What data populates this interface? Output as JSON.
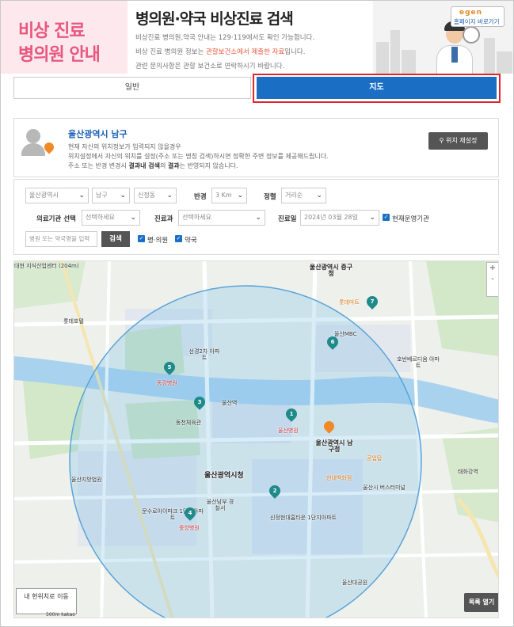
{
  "banner": {
    "left_line1": "비상 진료",
    "left_line2": "병의원 안내",
    "title": "병의원·약국 비상진료 검색",
    "info1": "비상진료 병의원,약국 안내는 129·119에서도 확인 가능합니다.",
    "info2_pre": "비상 진료 병의원 정보는 ",
    "info2_hl": "관할보건소에서 제출한 자료",
    "info2_post": "입니다.",
    "info3": "관련 문의사항은 관할 보건소로 연락하시기 바랍니다.",
    "home_logo": "egen",
    "home_label": "홈페이지 바로가기"
  },
  "tabs": {
    "normal": "일반",
    "map": "지도"
  },
  "location": {
    "title": "울산광역시 남구",
    "line1": "현재 자신의 위치정보가 입력되지 않을경우",
    "line2": "위치설정에서 자신의 위치를 설정(주소 또는 명칭 검색)하시면 정확한 주변 정보를 제공해드립니다.",
    "line3_pre": "주소 또는 반경 변경시 ",
    "line3_b1": "결과내 검색",
    "line3_mid": "의 ",
    "line3_b2": "결과",
    "line3_post": "는 반영되지 않습니다.",
    "reset_label": "위치 재설정"
  },
  "filters": {
    "city": "울산광역시",
    "district": "남구",
    "dong": "신정동",
    "radius_label": "반경",
    "radius": "3 Km",
    "sort_label": "정렬",
    "sort": "거리순",
    "org_label": "의료기관 선택",
    "org": "선택하세요",
    "dept_label": "진료과",
    "dept": "선택하세요",
    "date_label": "진료일",
    "date": "2024년 03월 28일",
    "open_now_label": "현재운영기관",
    "search_placeholder": "병원 또는 약국명을 입력",
    "search_button": "검색",
    "hospital_label": "병·의원",
    "pharmacy_label": "약국"
  },
  "map": {
    "zoom_in": "+",
    "zoom_out": "-",
    "my_location": "내 현위치로 이동",
    "list_open": "목록 열기",
    "scale": "500m",
    "provider": "kakao",
    "markers": [
      "1",
      "2",
      "3",
      "4",
      "5",
      "6",
      "7"
    ],
    "labels": {
      "gov": "울산광역시 남구청",
      "cityhall": "울산광역시청",
      "hospital1": "울산병원",
      "hospital4": "중앙병원",
      "hospital5": "동강병원",
      "seonam": "선경2차 아파트",
      "court": "울산지방법원",
      "police": "울산남부 경찰서",
      "mbc": "울산MBC",
      "daehyun": "대현 지식산업센터 (204m)",
      "junggu": "울산광역시 중구청",
      "taehwa": "태화강역",
      "lotte": "롯데호텔",
      "station": "울산역",
      "lottemart": "롯데마트",
      "apt1": "호반베르디움 아파트",
      "school": "울산대공원",
      "park": "동천체육관",
      "gongeop": "공업탑",
      "hyundai": "현대백화점",
      "ulsanbank": "울산시 버스터미널",
      "sinjeong": "신정현대홈타운 1단지아파트",
      "moonsu": "문수로아이파크 1단지아파트"
    }
  }
}
